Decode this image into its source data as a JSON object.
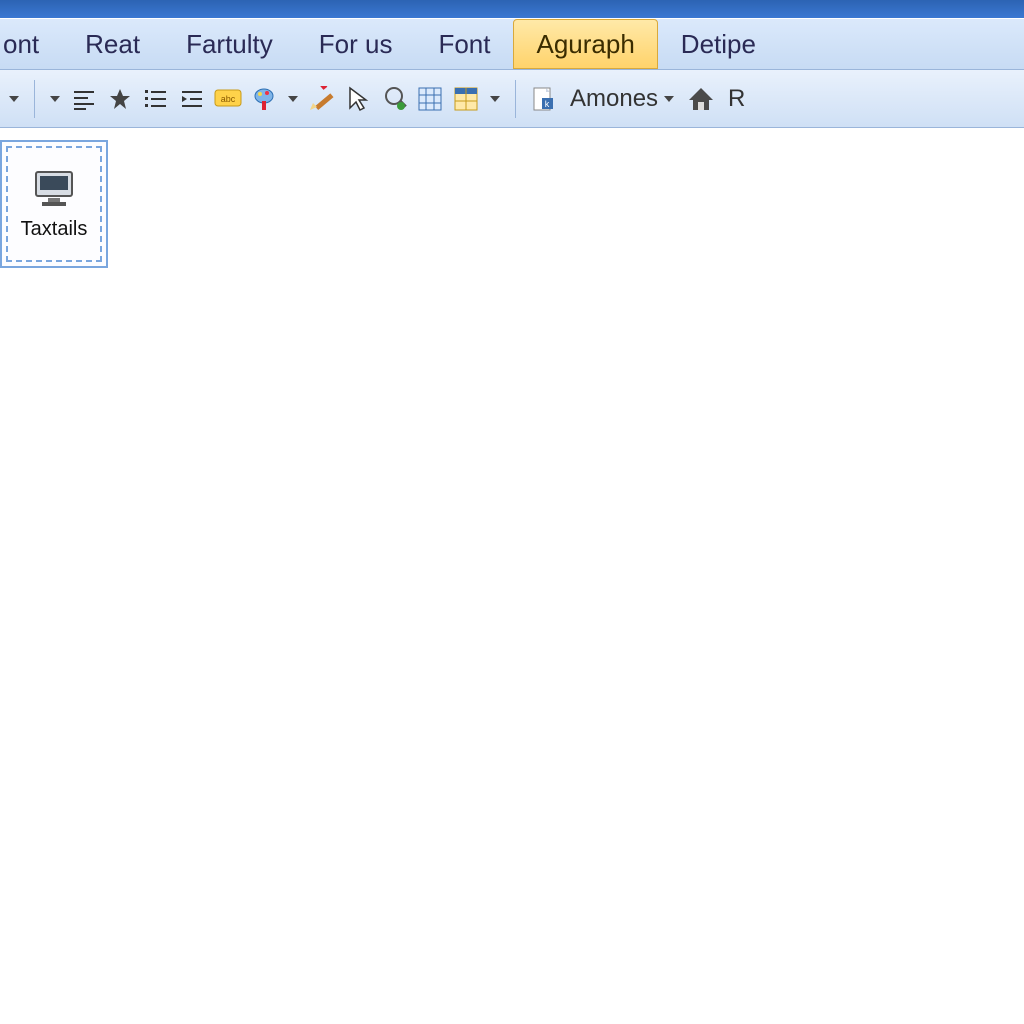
{
  "title_fragment": "",
  "menu": {
    "items": [
      {
        "label": "ont",
        "active": false
      },
      {
        "label": "Reat",
        "active": false
      },
      {
        "label": "Fartulty",
        "active": false
      },
      {
        "label": "For us",
        "active": false
      },
      {
        "label": "Font",
        "active": false
      },
      {
        "label": "Aguraph",
        "active": true
      },
      {
        "label": "Detipe",
        "active": false
      }
    ]
  },
  "toolbar": {
    "amones_label": "Amones",
    "r_fragment": "R"
  },
  "panel": {
    "label": "Taxtails"
  },
  "icons": {
    "align_left": "align-left-icon",
    "star": "star-icon",
    "list": "list-icon",
    "indent": "indent-icon",
    "tag": "tag-icon",
    "paint": "paint-icon",
    "pencil": "pencil-icon",
    "cursor": "cursor-icon",
    "link": "link-icon",
    "table1": "table-icon",
    "table2": "grid-icon",
    "doc": "doc-icon",
    "home": "home-icon",
    "monitor": "monitor-icon"
  }
}
